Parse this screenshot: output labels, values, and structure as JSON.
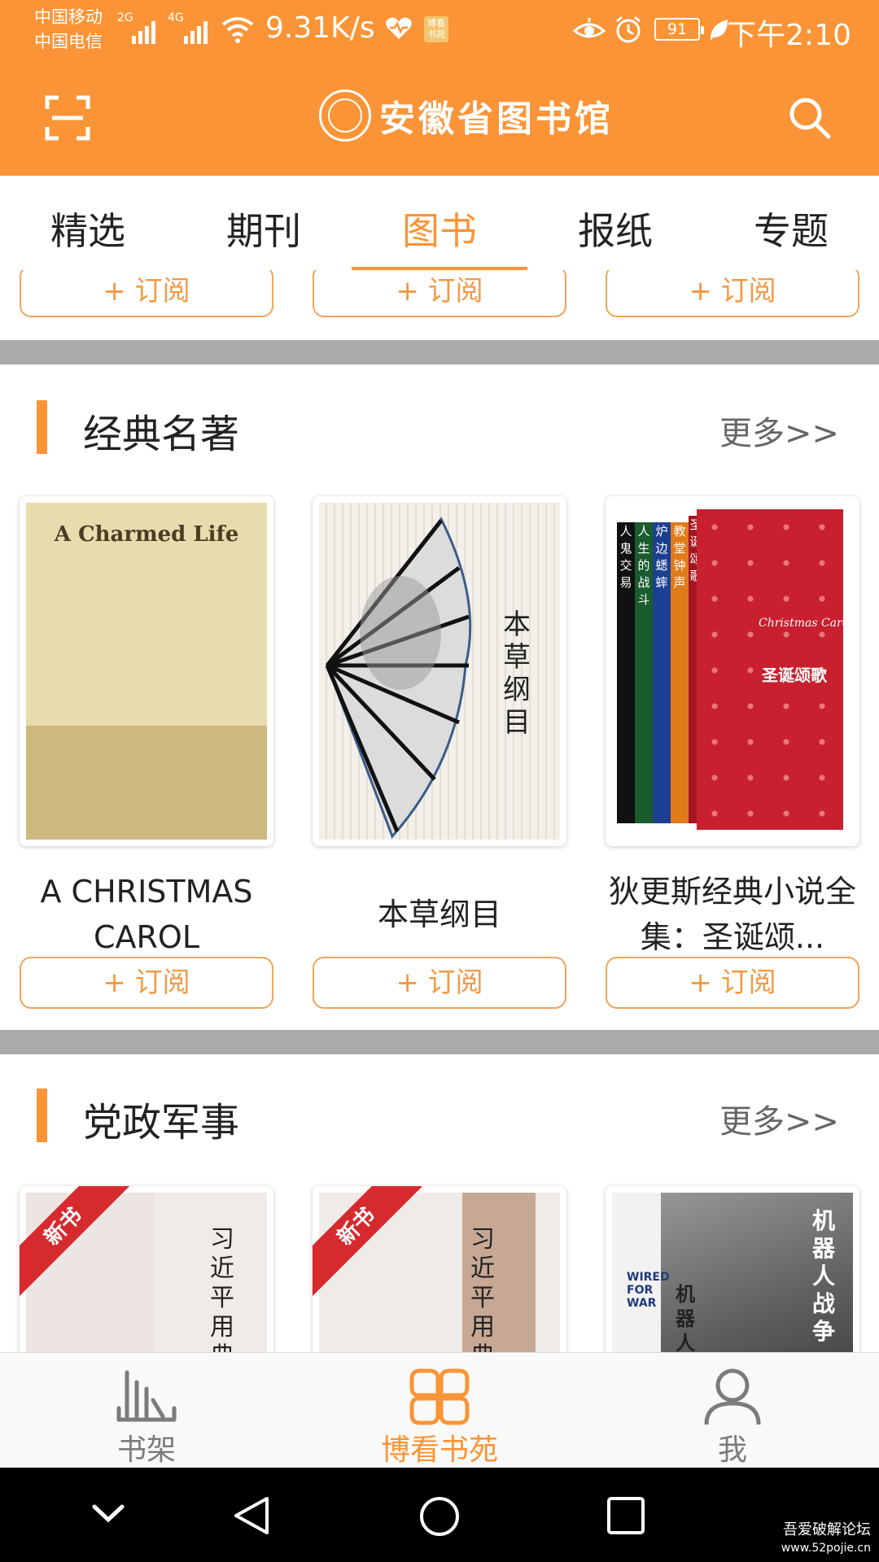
{
  "status_bar": {
    "carrier1": "中国移动",
    "carrier2": "中国电信",
    "net1": "2G",
    "net2": "4G",
    "speed": "9.31K/s",
    "badge": "博看书苑",
    "battery": "91",
    "time": "下午2:10"
  },
  "header": {
    "logo_text": "安徽省图书馆",
    "scan_icon": "scan-icon",
    "search_icon": "search-icon"
  },
  "tabs": [
    {
      "label": "精选",
      "active": false
    },
    {
      "label": "期刊",
      "active": false
    },
    {
      "label": "图书",
      "active": true
    },
    {
      "label": "报纸",
      "active": false
    },
    {
      "label": "专题",
      "active": false
    }
  ],
  "subscribe_label": "+ 订阅",
  "sections": [
    {
      "title": "经典名著",
      "more": "更多>>",
      "books": [
        {
          "title": "A CHRISTMAS CAROL",
          "cover_text": "A Charmed Life"
        },
        {
          "title": "本草纲目",
          "cover_text": "本草纲目"
        },
        {
          "title": "狄更斯经典小说全集：圣诞颂...",
          "cover_text": "Christmas Carol",
          "spines": [
            "人鬼交易",
            "人生的战斗",
            "炉边蟋蟀",
            "教堂钟声",
            "圣诞颂歌"
          ],
          "cover_title": "圣诞颂歌"
        }
      ]
    },
    {
      "title": "党政军事",
      "more": "更多>>",
      "books": [
        {
          "ribbon": "新书",
          "cover_text": "习近平用典"
        },
        {
          "ribbon": "新书",
          "cover_text": "习近平用典"
        },
        {
          "cover_text": "机器人战争",
          "cover_sub": "WIRED FOR WAR",
          "cover_side": "机器人战"
        }
      ]
    }
  ],
  "bottom_nav": [
    {
      "label": "书架",
      "icon": "bookshelf-icon",
      "active": false
    },
    {
      "label": "博看书苑",
      "icon": "clover-grid-icon",
      "active": true
    },
    {
      "label": "我",
      "icon": "person-icon",
      "active": false
    }
  ],
  "watermark": {
    "line1": "吾爱破解论坛",
    "line2": "www.52pojie.cn"
  },
  "colors": {
    "accent": "#fb9436",
    "divider": "#aaaaaa",
    "system_nav": "#000000"
  }
}
